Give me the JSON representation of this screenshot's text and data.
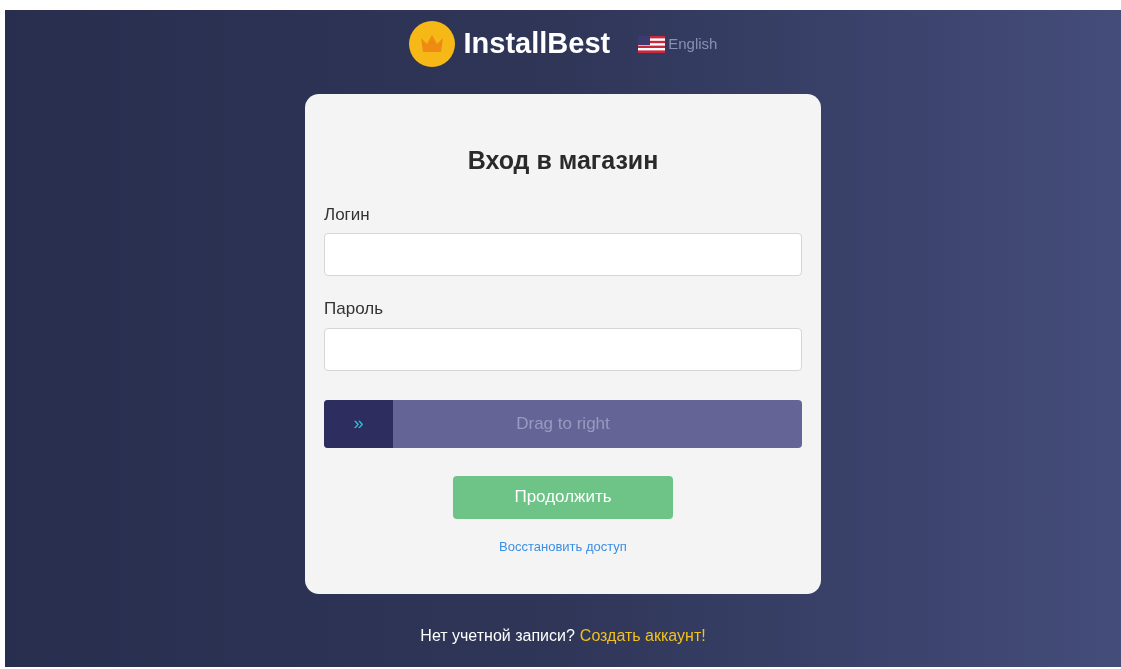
{
  "header": {
    "brand": "InstallBest",
    "language": "English"
  },
  "login_card": {
    "title": "Вход в магазин",
    "fields": [
      {
        "label": "Логин"
      },
      {
        "label": "Пароль"
      }
    ],
    "slider": {
      "label": "Drag to right",
      "thumb": "»",
      "level": 0
    },
    "submit_button": "Продолжить",
    "recover_link": "Восстановить доступ"
  },
  "footer": {
    "text": "Нет учетной записи?",
    "link": "Создать аккаунт!"
  }
}
